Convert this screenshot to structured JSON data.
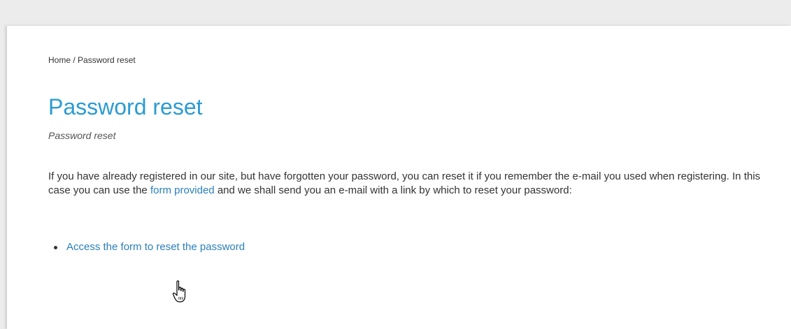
{
  "breadcrumb": {
    "home": "Home",
    "separator": " / ",
    "current": "Password reset"
  },
  "page": {
    "title": "Password reset",
    "subtitle": "Password reset"
  },
  "intro": {
    "text_before": "If you have already registered in our site, but have forgotten your password, you can reset it if you remember the e-mail you used when registering. In this case you can use the ",
    "link_text": "form provided",
    "text_after": " and we shall send you an e-mail with a link by which to reset your password:"
  },
  "links": [
    {
      "label": "Access the form to reset the password"
    }
  ],
  "colors": {
    "title": "#2b9bd3",
    "link": "#2a7fb8",
    "text": "#333333"
  },
  "icons": {
    "cursor": "hand-pointer-cursor-icon"
  }
}
